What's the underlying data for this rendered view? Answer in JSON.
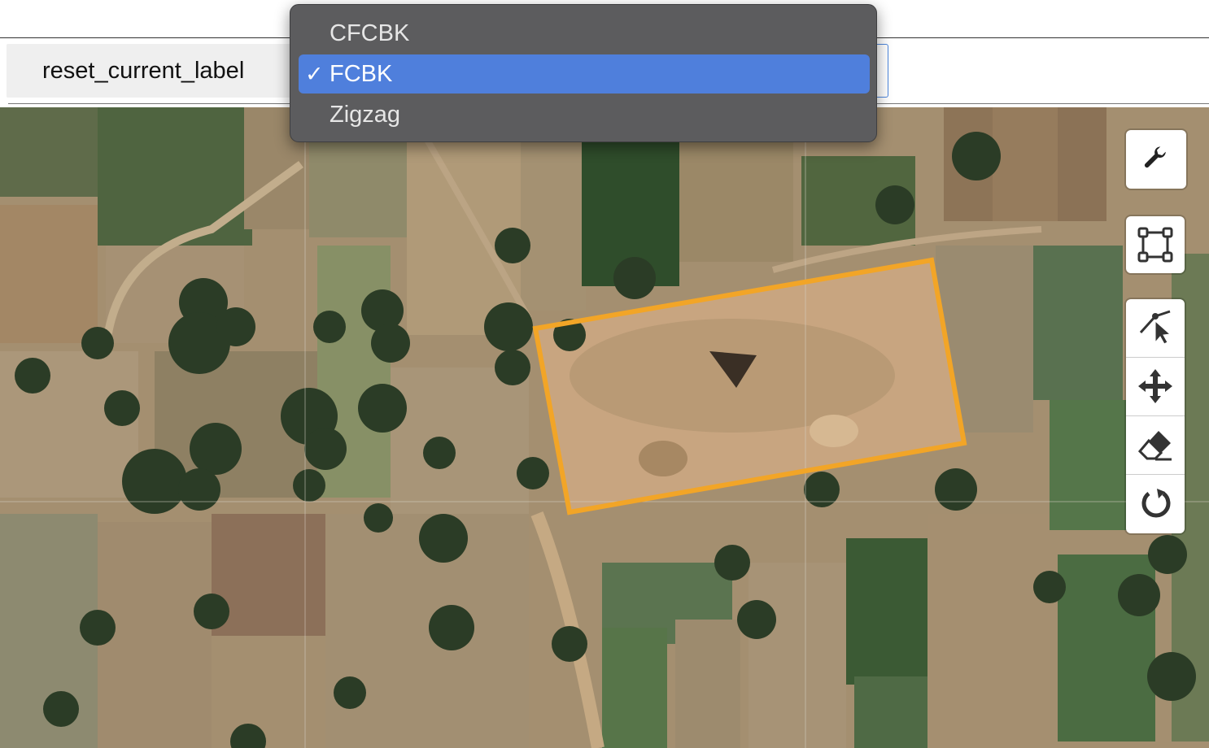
{
  "toolbar": {
    "reset_button_label": "reset_current_label"
  },
  "label_select": {
    "options": [
      {
        "label": "CFCBK",
        "selected": false
      },
      {
        "label": "FCBK",
        "selected": true
      },
      {
        "label": "Zigzag",
        "selected": false
      }
    ],
    "checkmark": "✓"
  },
  "map": {
    "annotation_color": "#f2a527",
    "controls": [
      {
        "icon": "wrench-icon"
      },
      {
        "icon": "draw-rectangle-icon"
      },
      {
        "icon": "edit-vertex-icon"
      },
      {
        "icon": "move-icon"
      },
      {
        "icon": "eraser-icon"
      },
      {
        "icon": "rotate-icon"
      }
    ]
  }
}
